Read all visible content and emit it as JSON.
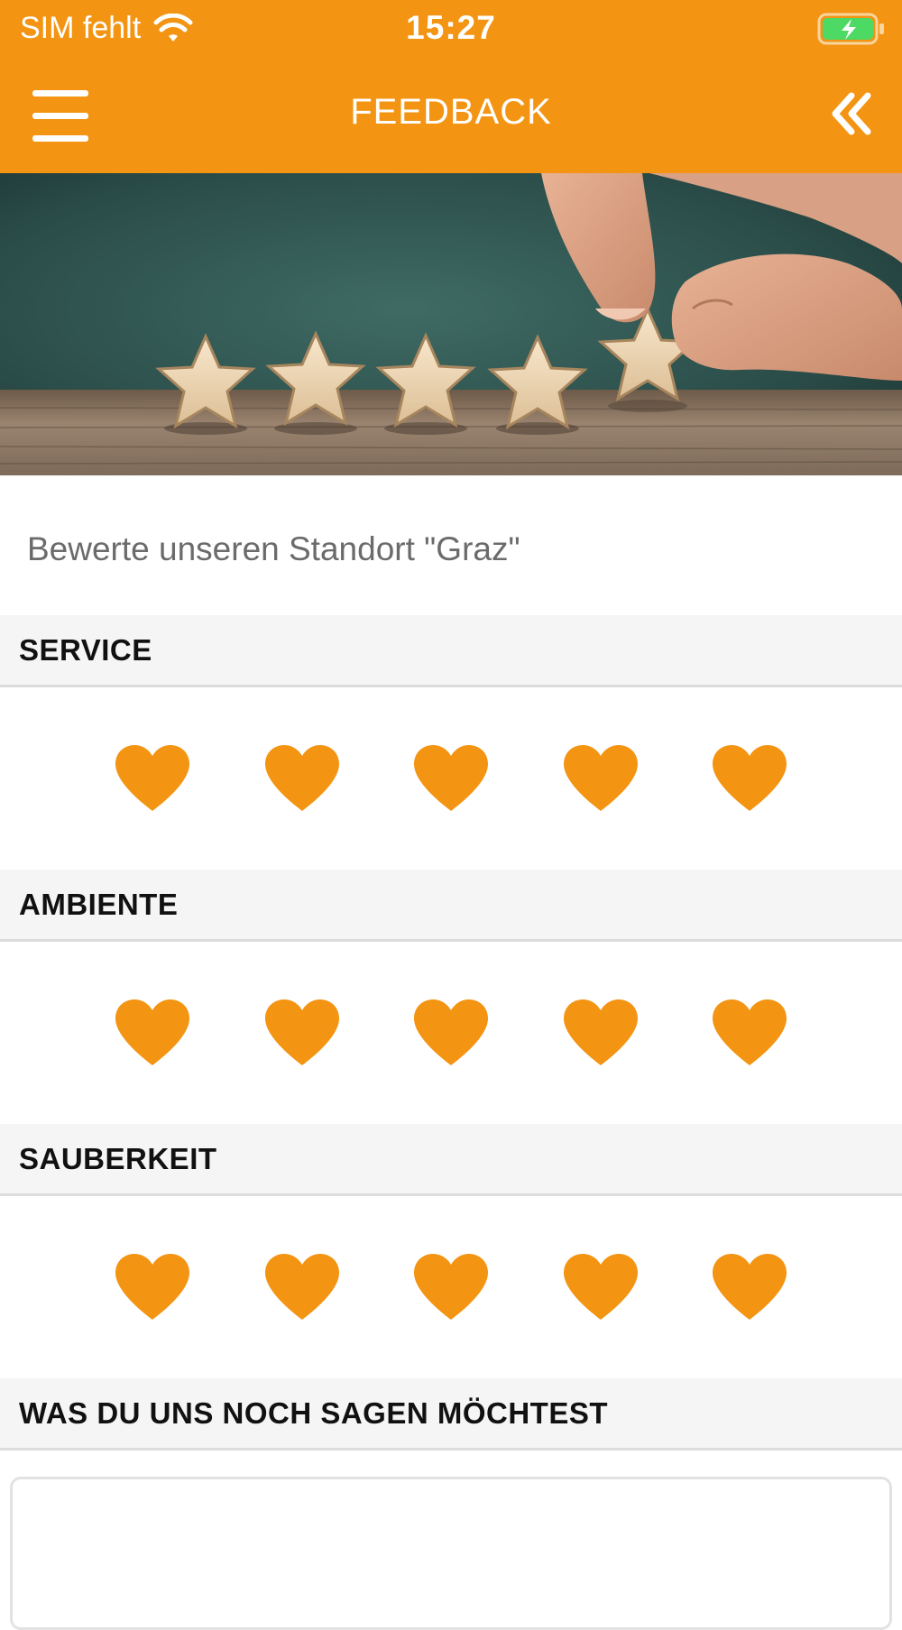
{
  "status_bar": {
    "carrier": "SIM fehlt",
    "time": "15:27",
    "battery_color": "#4CD964"
  },
  "nav": {
    "title": "FEEDBACK"
  },
  "subtitle": "Bewerte unseren Standort \"Graz\"",
  "sections": [
    {
      "label": "SERVICE",
      "rating": 5,
      "max": 5
    },
    {
      "label": "AMBIENTE",
      "rating": 5,
      "max": 5
    },
    {
      "label": "SAUBERKEIT",
      "rating": 5,
      "max": 5
    },
    {
      "label": "WAS DU UNS NOCH SAGEN MÖCHTEST"
    }
  ],
  "comment": {
    "value": "",
    "placeholder": ""
  },
  "colors": {
    "accent": "#F39412",
    "section_bg": "#f5f5f5",
    "heart": "#F39412"
  },
  "icons": {
    "menu": "hamburger-icon",
    "back": "double-chevron-left-icon",
    "wifi": "wifi-icon",
    "battery": "battery-charging-icon",
    "rating": "heart-icon"
  }
}
